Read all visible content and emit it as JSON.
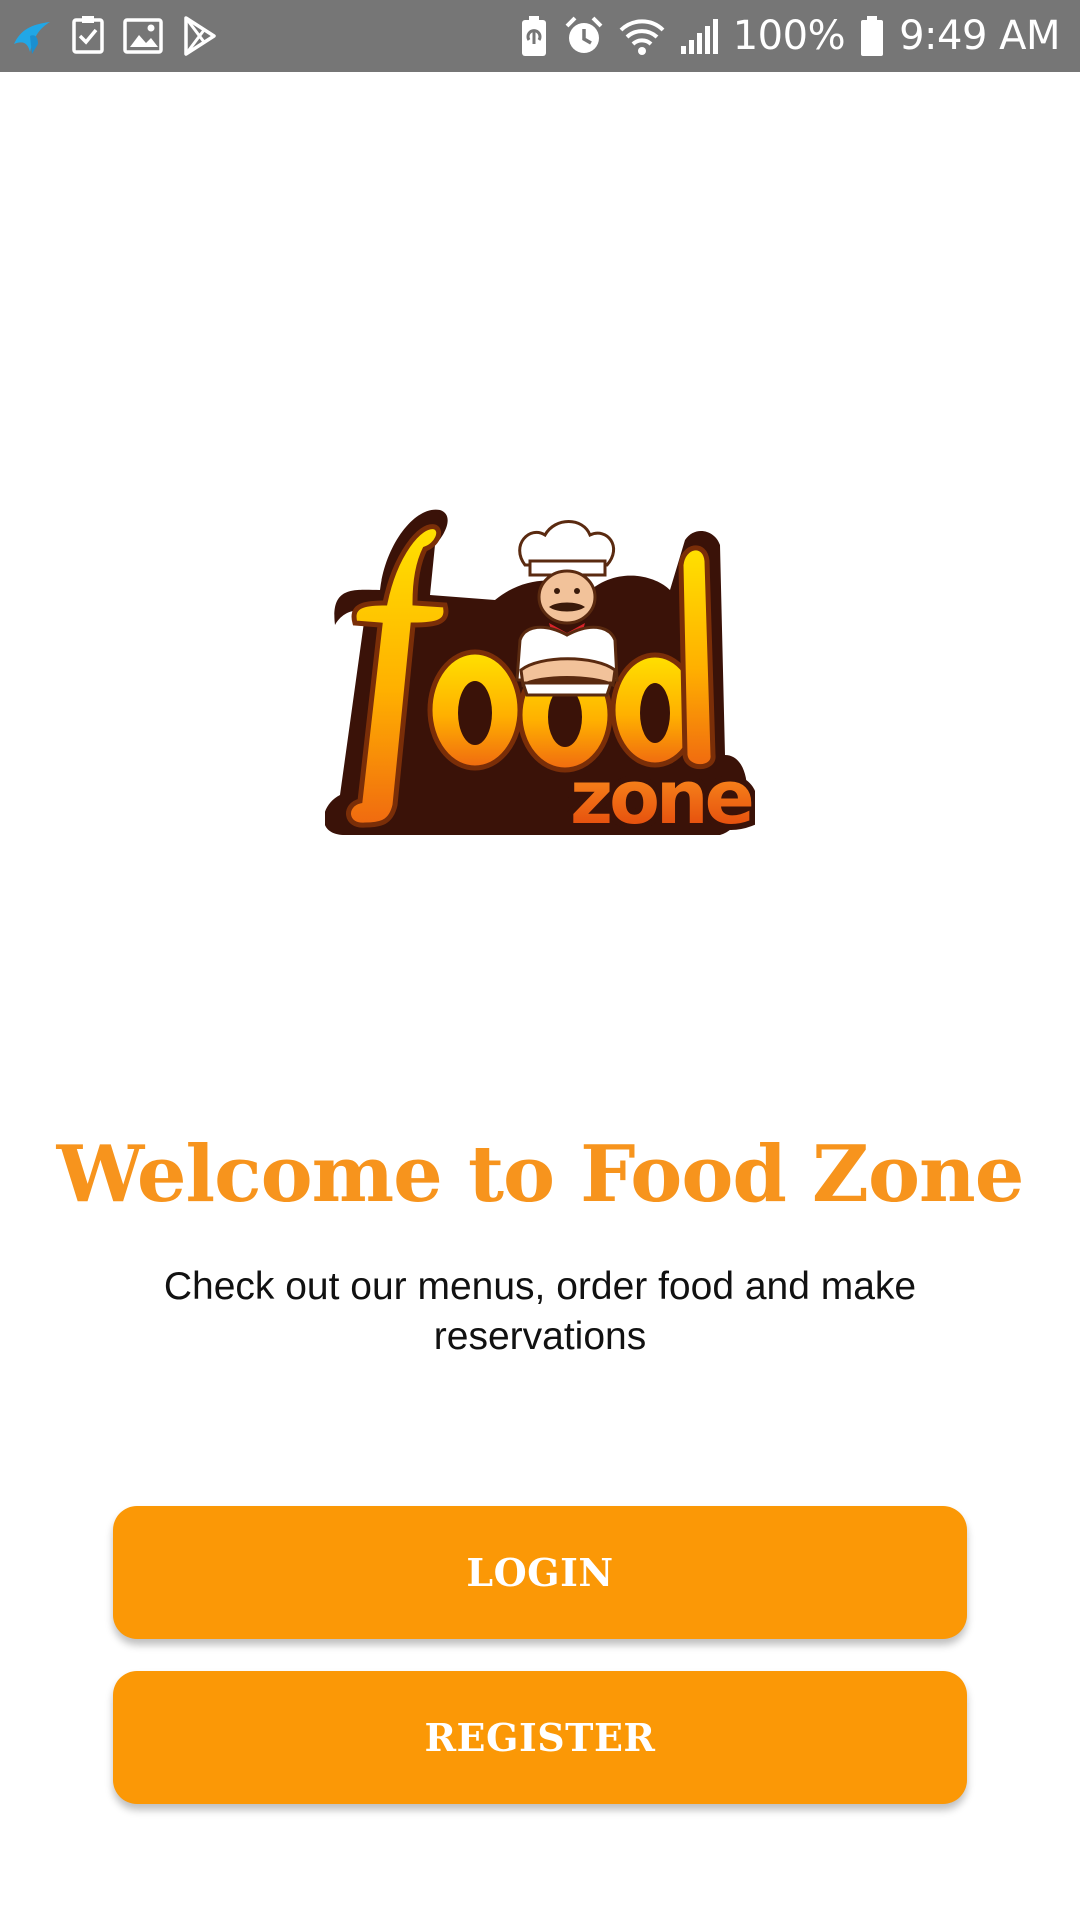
{
  "status_bar": {
    "left_icons": [
      "telenor-icon",
      "task-checkbox-icon",
      "gallery-icon",
      "play-store-icon"
    ],
    "right_icons": [
      "battery-saver-icon",
      "alarm-icon",
      "wifi-icon",
      "signal-icon",
      "battery-icon"
    ],
    "battery_percent": "100%",
    "time": "9:49 AM",
    "background_color": "#767676"
  },
  "logo": {
    "wordmark_top": "food",
    "wordmark_bottom": "zone",
    "image": "chef-mascot-logo"
  },
  "welcome": {
    "title": "Welcome to Food Zone",
    "subtitle": "Check out our menus, order food and make reservations"
  },
  "buttons": {
    "login_label": "LOGIN",
    "register_label": "REGISTER"
  },
  "colors": {
    "accent": "#fb9806",
    "title": "#f7941d"
  }
}
